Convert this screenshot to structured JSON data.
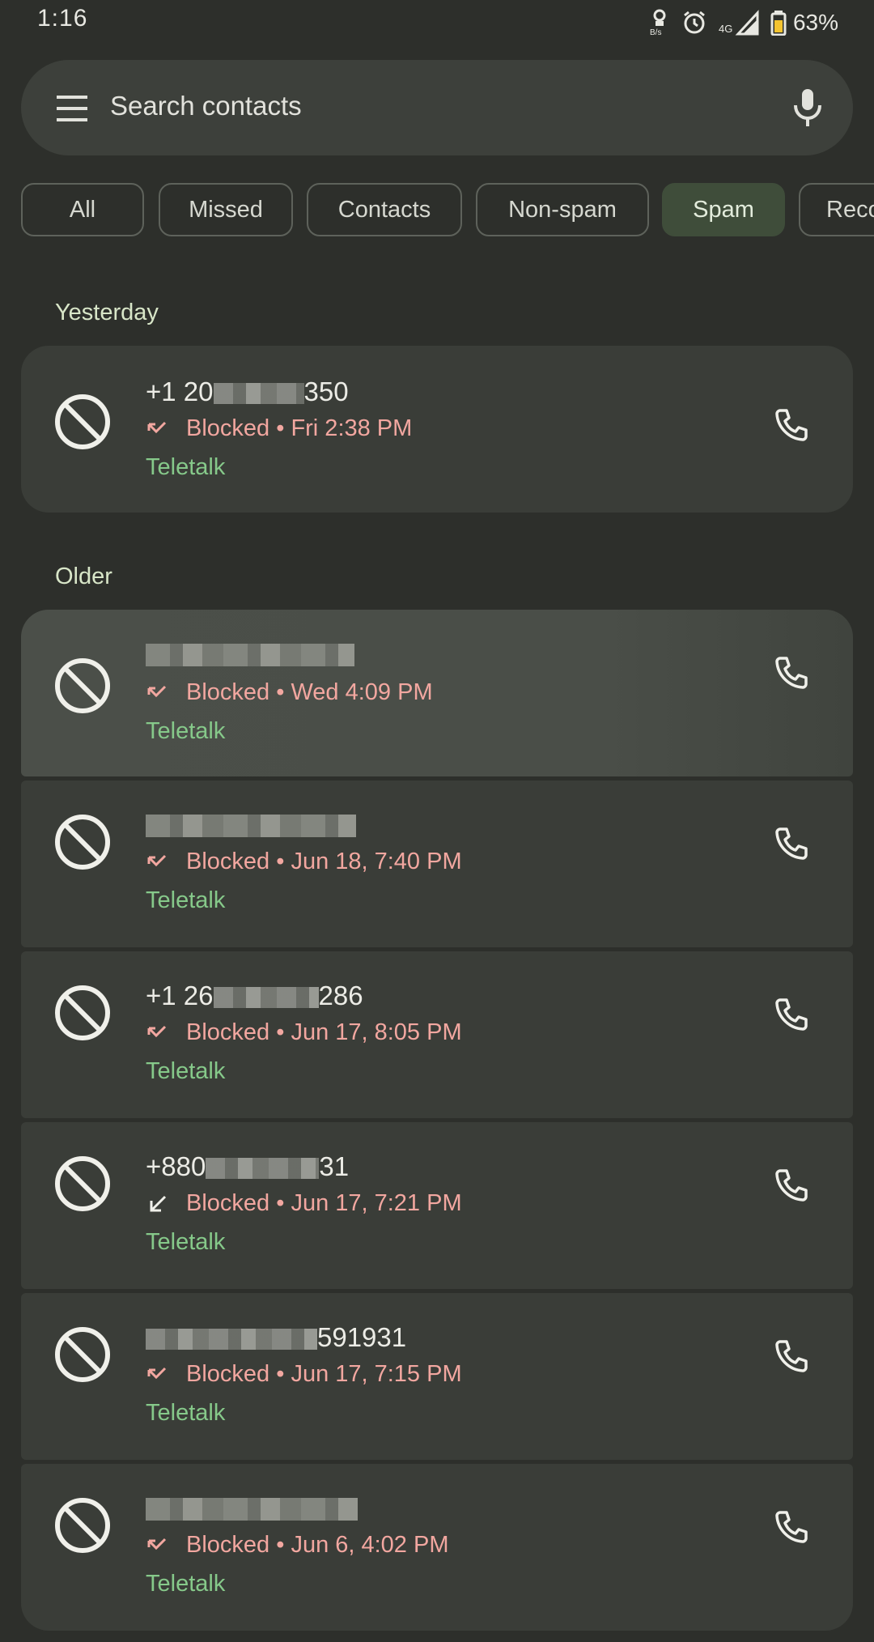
{
  "status_bar": {
    "time": "1:16",
    "net_speed_label": "B/s",
    "network_type": "4G",
    "battery": "63%"
  },
  "search": {
    "placeholder": "Search contacts"
  },
  "filters": [
    {
      "label": "All",
      "selected": false
    },
    {
      "label": "Missed",
      "selected": false
    },
    {
      "label": "Contacts",
      "selected": false
    },
    {
      "label": "Non-spam",
      "selected": false
    },
    {
      "label": "Spam",
      "selected": true
    },
    {
      "label": "Reco",
      "selected": false
    }
  ],
  "sections": {
    "yesterday": "Yesterday",
    "older": "Older"
  },
  "calls": [
    {
      "number_start": "+1 20",
      "number_end": "350",
      "status": "Blocked • Fri 2:38 PM",
      "carrier": "Teletalk",
      "direction": "missed"
    },
    {
      "number_start": "",
      "number_end": "",
      "status": "Blocked • Wed 4:09 PM",
      "carrier": "Teletalk",
      "direction": "missed"
    },
    {
      "number_start": "",
      "number_end": "",
      "status": "Blocked • Jun 18, 7:40 PM",
      "carrier": "Teletalk",
      "direction": "missed"
    },
    {
      "number_start": "+1 26",
      "number_end": "286",
      "status": "Blocked • Jun 17, 8:05 PM",
      "carrier": "Teletalk",
      "direction": "missed"
    },
    {
      "number_start": "+880",
      "number_end": "31",
      "status": "Blocked • Jun 17, 7:21 PM",
      "carrier": "Teletalk",
      "direction": "incoming"
    },
    {
      "number_start": "",
      "number_end": "591931",
      "status": "Blocked • Jun 17, 7:15 PM",
      "carrier": "Teletalk",
      "direction": "missed"
    },
    {
      "number_start": "",
      "number_end": "",
      "status": "Blocked • Jun 6, 4:02 PM",
      "carrier": "Teletalk",
      "direction": "missed"
    }
  ],
  "colors": {
    "background": "#2d2f2b",
    "card": "#3a3d38",
    "blocked_status": "#f2a7a0",
    "carrier": "#86c98a",
    "selected_chip": "#3f4d3a"
  },
  "icons": {
    "menu": "hamburger-menu-icon",
    "mic": "microphone-icon",
    "block": "block-icon",
    "call": "phone-icon",
    "missed": "missed-call-arrow-icon",
    "incoming": "incoming-call-arrow-icon"
  }
}
